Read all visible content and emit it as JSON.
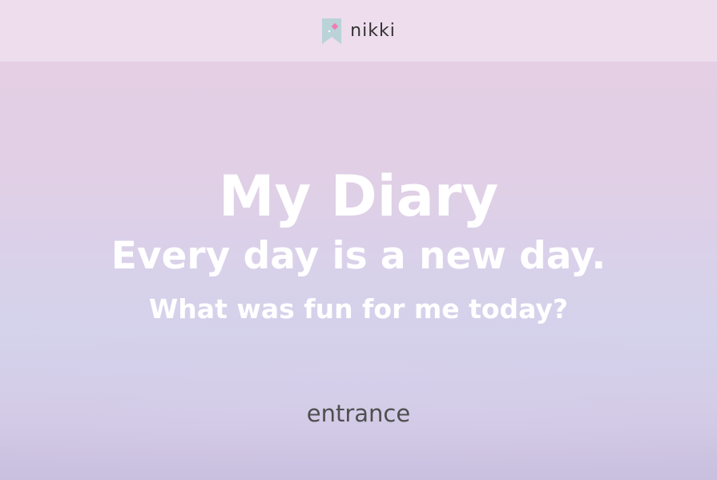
{
  "header": {
    "brand_name": "nikki",
    "logo_icon": "bookmark-icon",
    "colors": {
      "bookmark": "#b9d3d9",
      "diamond": "#f07ab1"
    }
  },
  "hero": {
    "title": "My Diary",
    "subtitle": "Every day is a new day.",
    "question": "What was fun for me today?"
  },
  "entrance": {
    "label": "entrance"
  },
  "colors": {
    "header_bg": "#eedff0",
    "background_top": "#e6cfe4",
    "background_bottom": "#c9bfdf",
    "hero_text": "#ffffff",
    "entrance_text": "#4f4f4f"
  }
}
